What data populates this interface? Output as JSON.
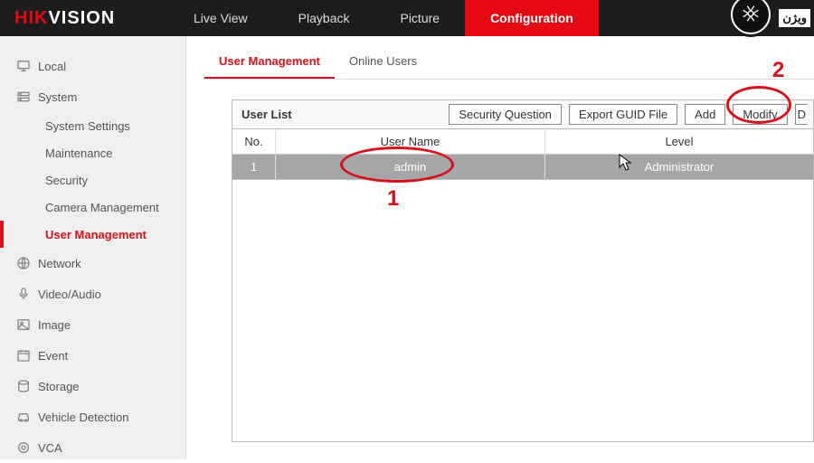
{
  "brand": {
    "part1": "HIK",
    "part2": "VISION"
  },
  "nav": {
    "items": [
      {
        "label": "Live View"
      },
      {
        "label": "Playback"
      },
      {
        "label": "Picture"
      },
      {
        "label": "Configuration"
      }
    ]
  },
  "corner_text": "ویژن",
  "sidebar": {
    "items": [
      {
        "label": "Local",
        "icon": "monitor"
      },
      {
        "label": "System",
        "icon": "system",
        "children": [
          {
            "label": "System Settings"
          },
          {
            "label": "Maintenance"
          },
          {
            "label": "Security"
          },
          {
            "label": "Camera Management"
          },
          {
            "label": "User Management",
            "active": true
          }
        ]
      },
      {
        "label": "Network",
        "icon": "globe"
      },
      {
        "label": "Video/Audio",
        "icon": "mic"
      },
      {
        "label": "Image",
        "icon": "image"
      },
      {
        "label": "Event",
        "icon": "calendar"
      },
      {
        "label": "Storage",
        "icon": "storage"
      },
      {
        "label": "Vehicle Detection",
        "icon": "car"
      },
      {
        "label": "VCA",
        "icon": "vca"
      }
    ]
  },
  "subtabs": {
    "items": [
      {
        "label": "User Management",
        "active": true
      },
      {
        "label": "Online Users"
      }
    ]
  },
  "user_panel": {
    "title": "User List",
    "buttons": {
      "security_question": "Security Question",
      "export_guid": "Export GUID File",
      "add": "Add",
      "modify": "Modify",
      "delete_initial": "D"
    },
    "columns": {
      "no": "No.",
      "username": "User Name",
      "level": "Level"
    },
    "rows": [
      {
        "no": "1",
        "username": "admin",
        "level": "Administrator"
      }
    ]
  },
  "annotations": {
    "one": "1",
    "two": "2"
  }
}
